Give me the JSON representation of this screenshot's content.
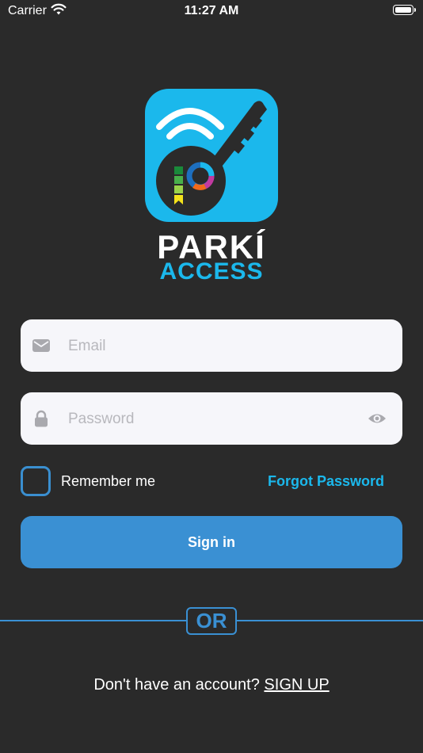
{
  "status_bar": {
    "carrier": "Carrier",
    "time": "11:27 AM"
  },
  "brand": {
    "line1": "PARKÍ",
    "line2": "ACCESS",
    "logo_icon": "key-wifi-logo"
  },
  "form": {
    "email": {
      "placeholder": "Email",
      "value": "",
      "icon": "mail-icon"
    },
    "password": {
      "placeholder": "Password",
      "value": "",
      "icon": "lock-icon",
      "toggle_icon": "eye-icon"
    },
    "remember_label": "Remember me",
    "remember_checked": false,
    "forgot_label": "Forgot Password",
    "signin_label": "Sign in"
  },
  "divider": {
    "label": "OR"
  },
  "signup": {
    "prompt": "Don't have an account?",
    "link": "SIGN UP"
  },
  "colors": {
    "background": "#2a2a2a",
    "accent_cyan": "#1bb8ec",
    "accent_blue": "#3a90d3",
    "field_bg": "#f6f6fa"
  }
}
